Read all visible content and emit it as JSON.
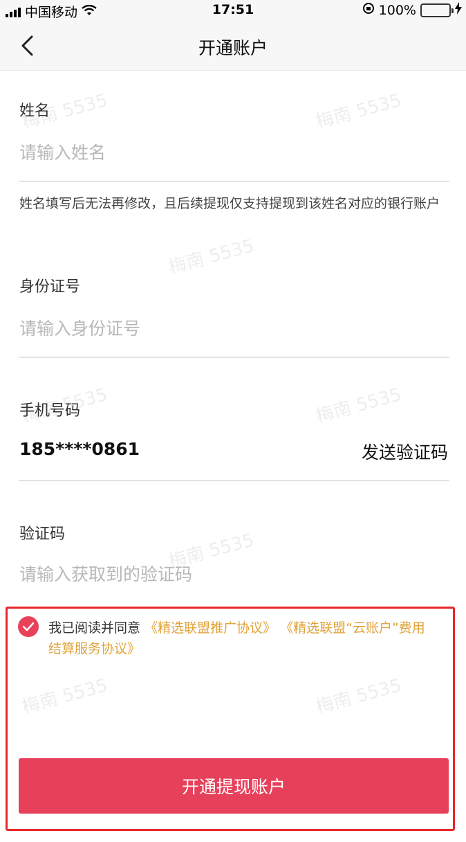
{
  "status_bar": {
    "carrier": "中国移动",
    "time": "17:51",
    "battery": "100%",
    "battery_level": 1.0
  },
  "nav": {
    "title": "开通账户",
    "back_icon": "chevron-left-icon"
  },
  "form": {
    "name": {
      "label": "姓名",
      "placeholder": "请输入姓名",
      "value": ""
    },
    "name_hint": "姓名填写后无法再修改，且后续提现仅支持提现到该姓名对应的银行账户",
    "id_number": {
      "label": "身份证号",
      "placeholder": "请输入身份证号",
      "value": ""
    },
    "phone": {
      "label": "手机号码",
      "value": "185****0861",
      "send_code_label": "发送验证码"
    },
    "code": {
      "label": "验证码",
      "placeholder": "请输入获取到的验证码",
      "value": ""
    }
  },
  "agreement": {
    "checked": true,
    "prefix": "我已阅读并同意",
    "links": [
      "《精选联盟推广协议》",
      "《精选联盟“云账户”费用结算服务协议》"
    ]
  },
  "submit_label": "开通提现账户",
  "watermark": "梅南 5535",
  "colors": {
    "accent": "#e6405a",
    "link": "#e0a33a",
    "highlight_border": "#e8262b"
  }
}
